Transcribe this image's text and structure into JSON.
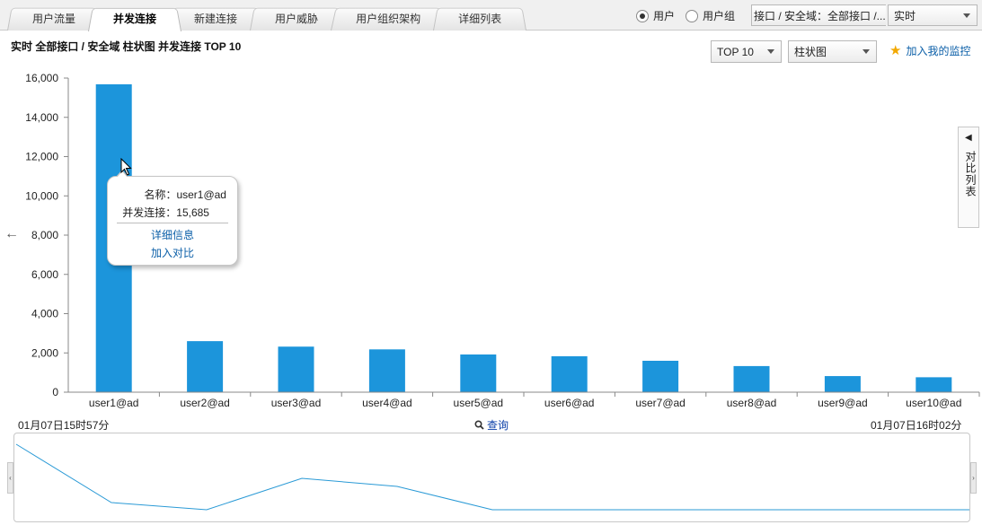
{
  "tabs": [
    {
      "label": "用户流量",
      "active": false
    },
    {
      "label": "并发连接",
      "active": true
    },
    {
      "label": "新建连接",
      "active": false
    },
    {
      "label": "用户威胁",
      "active": false
    },
    {
      "label": "用户组织架构",
      "active": false
    },
    {
      "label": "详细列表",
      "active": false
    }
  ],
  "scope": {
    "options": [
      {
        "label": "用户",
        "checked": true
      },
      {
        "label": "用户组",
        "checked": false
      }
    ]
  },
  "interface_select": {
    "value": "接口 / 安全域：全部接口 /..."
  },
  "period_select": {
    "value": "实时"
  },
  "chart_title": "实时  全部接口 / 安全域  柱状图  并发连接  TOP 10",
  "topn_select": {
    "value": "TOP 10"
  },
  "type_select": {
    "value": "柱状图"
  },
  "monitor_link": {
    "label": "加入我的监控",
    "icon": "star-icon"
  },
  "compare_panel": {
    "label": "对比列表",
    "icon": "triangle-left-icon"
  },
  "tooltip": {
    "name_label": "名称：user1@ad",
    "conn_label": "并发连接：15,685",
    "detail_link": "详细信息",
    "compare_link": "加入对比"
  },
  "time_range": {
    "start": "01月07日15时57分",
    "end": "01月07日16时02分",
    "query_label": "查询"
  },
  "colors": {
    "bar": "#1c95db",
    "overview_line": "#2a9ad6",
    "link": "#0b5fa8"
  },
  "chart_data": {
    "type": "bar",
    "categories": [
      "user1@ad",
      "user2@ad",
      "user3@ad",
      "user4@ad",
      "user5@ad",
      "user6@ad",
      "user7@ad",
      "user8@ad",
      "user9@ad",
      "user10@ad"
    ],
    "values": [
      15685,
      2600,
      2320,
      2180,
      1920,
      1830,
      1600,
      1330,
      820,
      760
    ],
    "yticks": [
      0,
      2000,
      4000,
      6000,
      8000,
      10000,
      12000,
      14000,
      16000
    ],
    "ytick_labels": [
      "0",
      "2,000",
      "4,000",
      "6,000",
      "8,000",
      "10,000",
      "12,000",
      "14,000",
      "16,000"
    ],
    "ylim": [
      0,
      16000
    ],
    "grid": false,
    "legend": "none"
  }
}
